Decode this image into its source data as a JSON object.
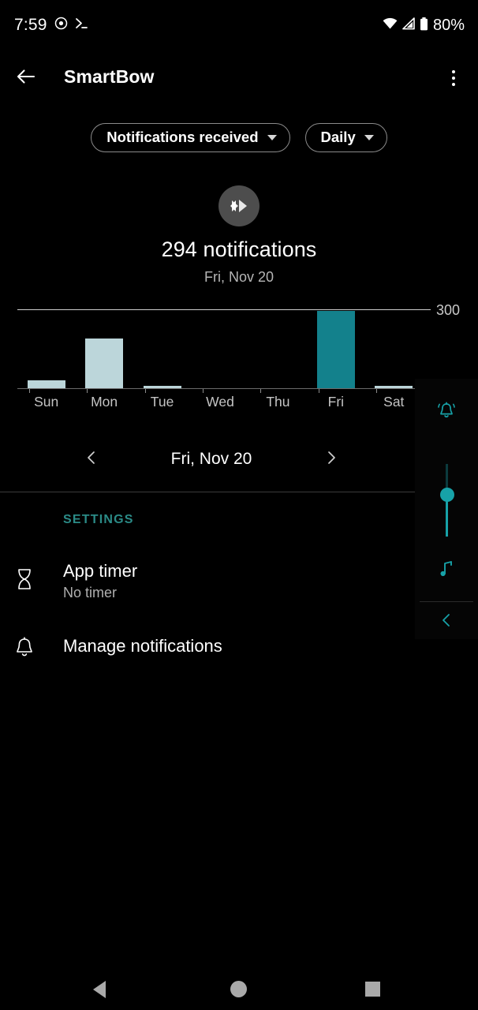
{
  "status_bar": {
    "time": "7:59",
    "battery_text": "80%",
    "icons": [
      "record-icon",
      "terminal-icon",
      "wifi-icon",
      "cellular-signal-icon",
      "battery-icon"
    ]
  },
  "app_bar": {
    "title": "SmartBow",
    "back_icon": "back-arrow-icon",
    "overflow_icon": "more-vertical-icon"
  },
  "filters": {
    "metric": {
      "label": "Notifications received",
      "caret": "chevron-down-icon"
    },
    "period": {
      "label": "Daily",
      "caret": "chevron-down-icon"
    }
  },
  "summary": {
    "app_icon": "smartbow-app-icon",
    "headline": "294 notifications",
    "subline": "Fri, Nov 20"
  },
  "chart_data": {
    "type": "bar",
    "title": "294 notifications",
    "subtitle": "Fri, Nov 20",
    "categories": [
      "Sun",
      "Mon",
      "Tue",
      "Wed",
      "Thu",
      "Fri",
      "Sat"
    ],
    "values": [
      30,
      190,
      4,
      0,
      0,
      294,
      6
    ],
    "highlight_index": 5,
    "xlabel": "",
    "ylabel": "",
    "ylim": [
      0,
      300
    ],
    "gridlines": [
      300
    ],
    "gridline_labels": [
      "300"
    ],
    "legend": [],
    "colors": {
      "bar": "#bcd6da",
      "bar_highlight": "#13818c",
      "axis": "#6b6b6b",
      "gridline": "#cfcfcf"
    }
  },
  "date_nav": {
    "prev_icon": "chevron-left-icon",
    "label": "Fri, Nov 20",
    "next_icon": "chevron-right-icon"
  },
  "settings": {
    "header": "SETTINGS",
    "items": [
      {
        "icon": "hourglass-icon",
        "title": "App timer",
        "subtitle": "No timer"
      },
      {
        "icon": "bell-icon",
        "title": "Manage notifications",
        "subtitle": ""
      }
    ]
  },
  "volume_overlay": {
    "ringer_icon": "bell-ringing-icon",
    "slider_value": 60,
    "media_icon": "music-note-icon",
    "collapse_icon": "chevron-left-icon",
    "accent_color": "#17a2a8"
  },
  "nav_bar": {
    "back_icon": "nav-back-icon",
    "home_icon": "nav-home-icon",
    "recents_icon": "nav-recents-icon"
  }
}
